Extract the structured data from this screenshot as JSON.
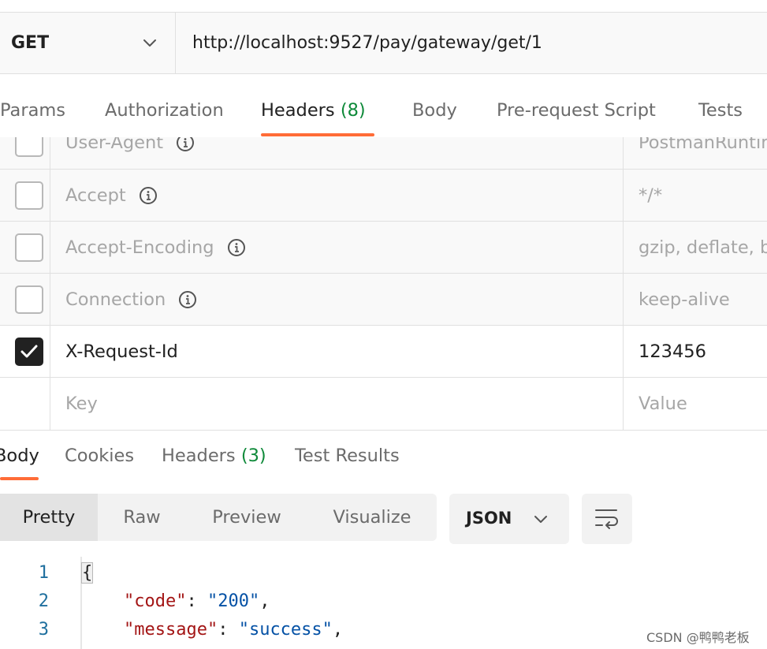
{
  "request": {
    "method": "GET",
    "url": "http://localhost:9527/pay/gateway/get/1"
  },
  "request_tabs": {
    "params": "Params",
    "authorization": "Authorization",
    "headers": "Headers",
    "headers_count": "(8)",
    "body": "Body",
    "prerequest": "Pre-request Script",
    "tests": "Tests",
    "active": "Headers"
  },
  "headers_table": {
    "rows": [
      {
        "key": "User-Agent",
        "value": "PostmanRuntime",
        "checked": false
      },
      {
        "key": "Accept",
        "value": "*/*",
        "checked": false
      },
      {
        "key": "Accept-Encoding",
        "value": "gzip, deflate, br",
        "checked": false
      },
      {
        "key": "Connection",
        "value": "keep-alive",
        "checked": false
      },
      {
        "key": "X-Request-Id",
        "value": "123456",
        "checked": true
      }
    ],
    "key_placeholder": "Key",
    "value_placeholder": "Value"
  },
  "response_tabs": {
    "body": "Body",
    "cookies": "Cookies",
    "headers": "Headers",
    "headers_count": "(3)",
    "test_results": "Test Results",
    "active": "Body"
  },
  "view_modes": {
    "pretty": "Pretty",
    "raw": "Raw",
    "preview": "Preview",
    "visualize": "Visualize",
    "active": "Pretty"
  },
  "format": {
    "selected": "JSON"
  },
  "code": {
    "line_numbers": [
      "1",
      "2",
      "3"
    ],
    "line1": "{",
    "line2_key": "\"code\"",
    "line2_sep": ": ",
    "line2_value": "\"200\"",
    "line2_end": ",",
    "line3_key": "\"message\"",
    "line3_sep": ": ",
    "line3_value": "\"success\"",
    "line3_end": ","
  },
  "watermark": "CSDN @鸭鸭老板",
  "colors": {
    "accent": "#ff6c37",
    "count_green": "#0f8a3a",
    "json_key": "#a31515",
    "json_string": "#0451a5",
    "line_number": "#1f6f9e"
  },
  "icons": {
    "method_dropdown": "chevron-down-icon",
    "info": "info-icon",
    "check": "check-icon",
    "wrap": "wrap-lines-icon"
  }
}
